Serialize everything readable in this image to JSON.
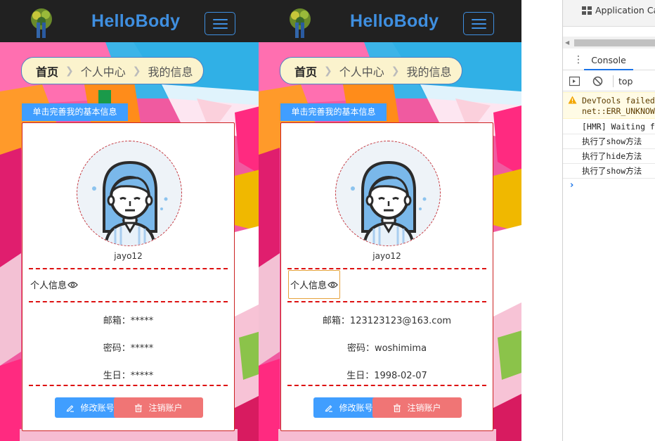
{
  "app": {
    "brand": "HelloBody"
  },
  "breadcrumb": {
    "home": "首页",
    "level2": "个人中心",
    "level3": "我的信息"
  },
  "tag_label": "单击完善我的基本信息",
  "panels": [
    {
      "username": "jayo12",
      "info_title": "个人信息",
      "email": "邮箱：*****",
      "password": "密码：*****",
      "birthday": "生日：*****",
      "edit_button": "修改账号",
      "delete_button": "注销账户"
    },
    {
      "username": "jayo12",
      "info_title": "个人信息",
      "email": "邮箱：123123123@163.com",
      "password": "密码：woshimima",
      "birthday": "生日：1998-02-07",
      "edit_button": "修改账号",
      "delete_button": "注销账户"
    }
  ],
  "devtools": {
    "top_tab": "Application Ca",
    "console_tab": "Console",
    "context": "top",
    "warning_line1": "DevTools failed",
    "warning_line2": "net::ERR_UNKNOW",
    "logs": [
      "[HMR] Waiting f",
      "执行了show方法",
      "执行了hide方法",
      "执行了show方法"
    ],
    "prompt": "›"
  },
  "colors": {
    "accent": "#409eff",
    "danger": "#f07575",
    "topbar": "#212121",
    "brand": "#3f8fe0"
  }
}
